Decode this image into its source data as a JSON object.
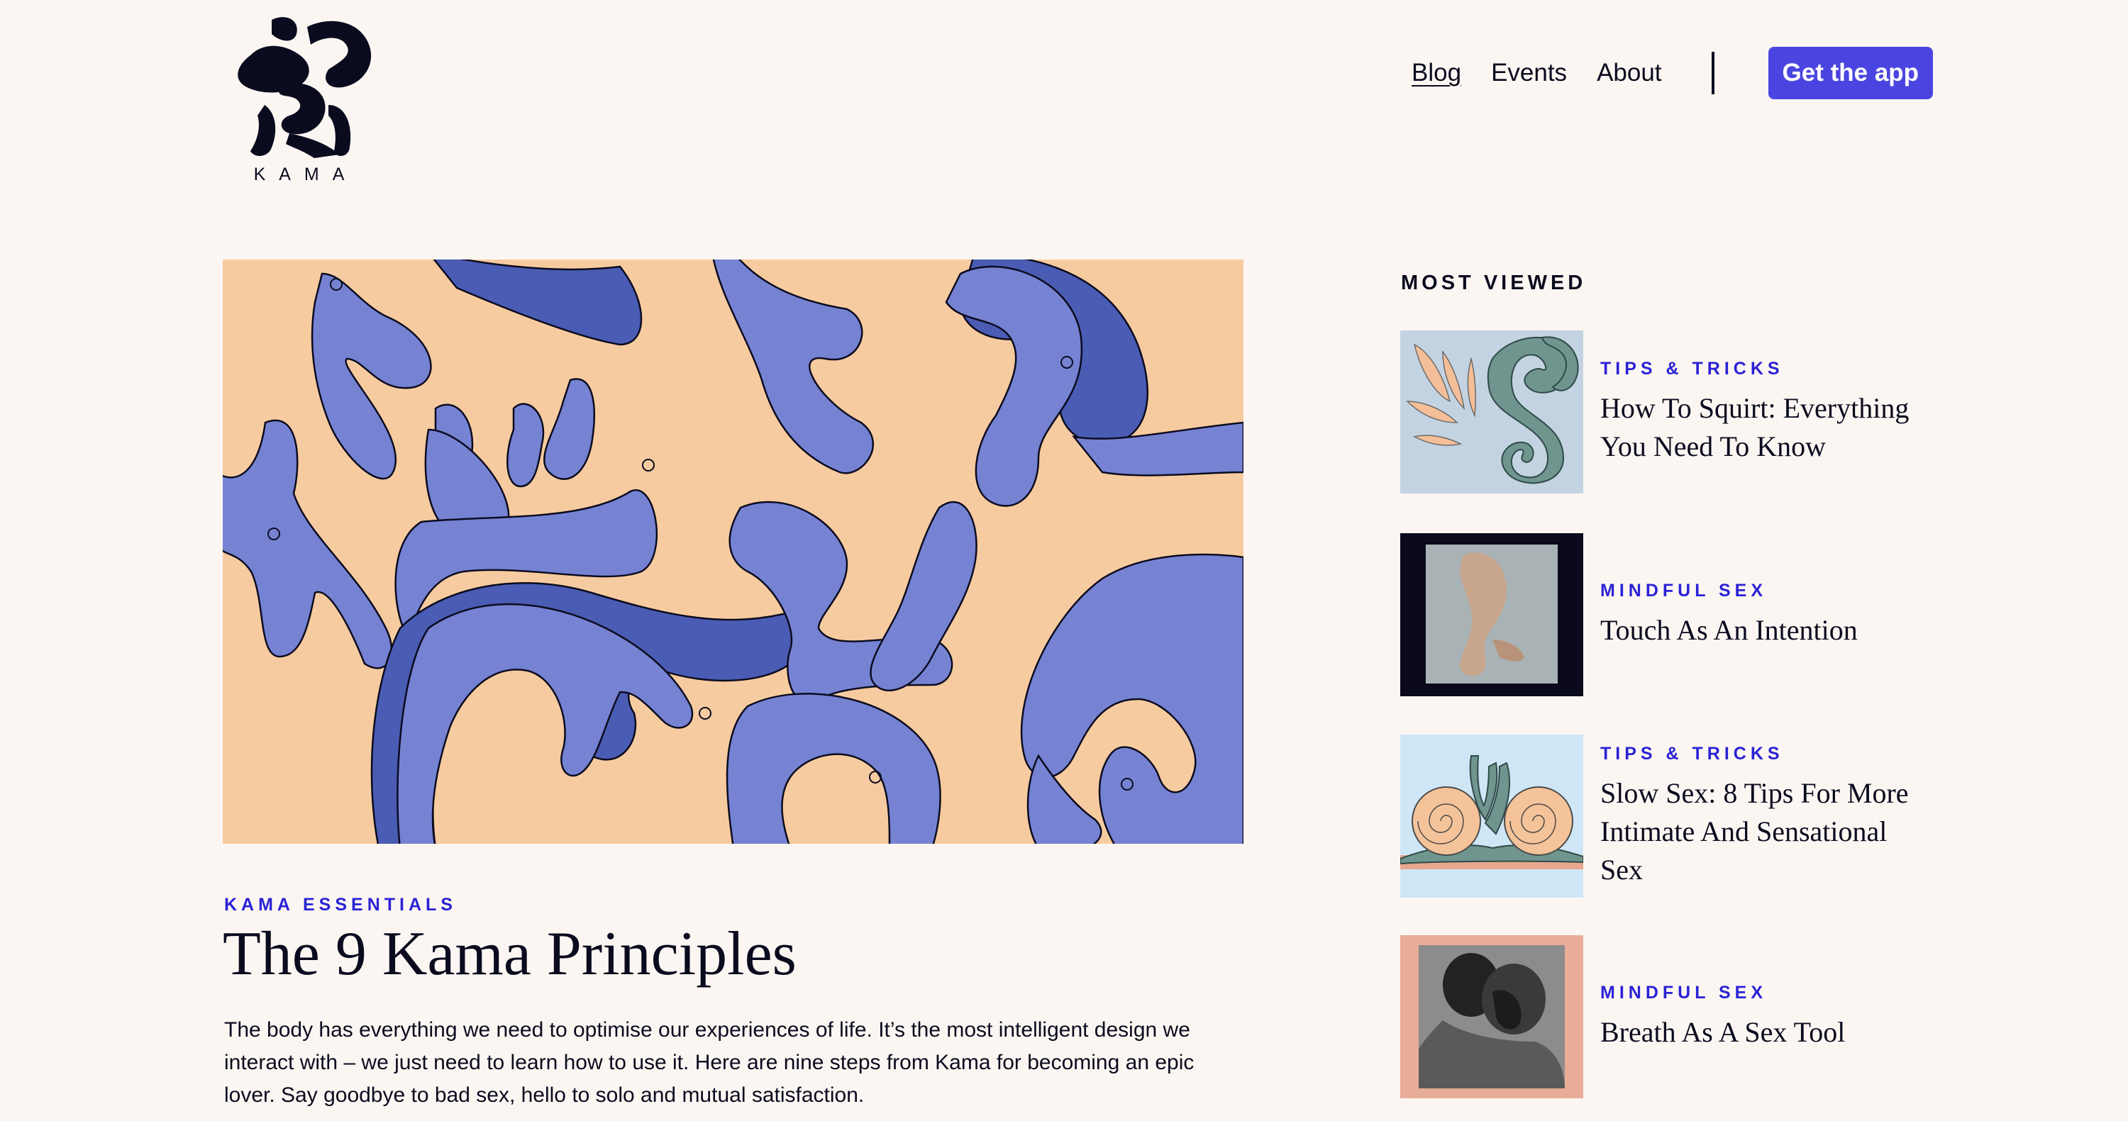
{
  "header": {
    "logo_text": "KAMA",
    "nav": [
      {
        "label": "Blog",
        "active": true
      },
      {
        "label": "Events",
        "active": false
      },
      {
        "label": "About",
        "active": false
      }
    ],
    "cta_label": "Get the app"
  },
  "colors": {
    "background": "#fcf6f2",
    "accent": "#4a45e0",
    "category": "#2a22d6",
    "text": "#0b0b1f",
    "hero_bg": "#f7cba0",
    "hero_shape": "#7683d3",
    "hero_shape_dark": "#4a5cb3"
  },
  "featured": {
    "category": "KAMA ESSENTIALS",
    "title": "The 9 Kama Principles",
    "excerpt": "The body has everything we need to optimise our experiences of life. It’s the most intelligent design we interact with – we just need to learn how to use it. Here are nine steps from Kama for becoming an epic lover. Say goodbye to bad sex, hello to solo and mutual satisfaction.",
    "image_icon": "abstract-figures-illustration"
  },
  "most_viewed": {
    "heading": "MOST VIEWED",
    "items": [
      {
        "category": "TIPS & TRICKS",
        "title": "How To Squirt: Everything You Need To Know",
        "thumb_icon": "swirl-illustration"
      },
      {
        "category": "MINDFUL SEX",
        "title": "Touch As An Intention",
        "thumb_icon": "photo-thumbnail"
      },
      {
        "category": "TIPS & TRICKS",
        "title": "Slow Sex: 8 Tips For More Intimate And Sensational Sex",
        "thumb_icon": "snail-illustration"
      },
      {
        "category": "MINDFUL SEX",
        "title": "Breath As A Sex Tool",
        "thumb_icon": "photo-thumbnail"
      }
    ]
  }
}
